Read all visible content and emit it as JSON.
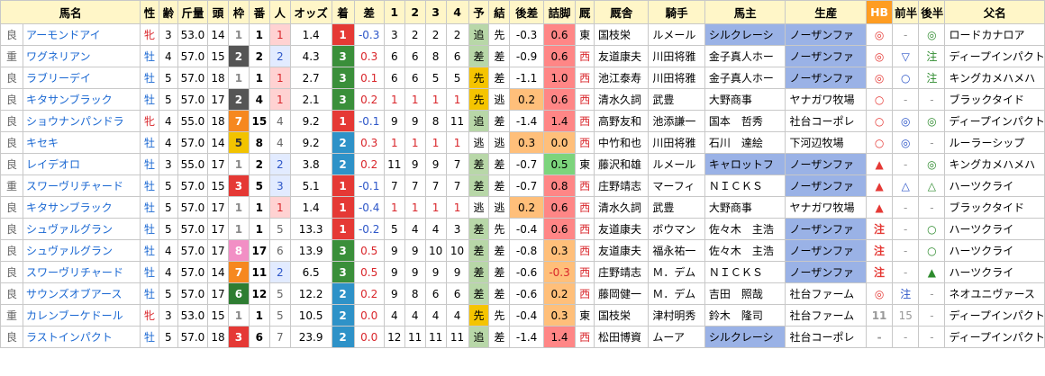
{
  "header": [
    "馬名",
    "性",
    "齢",
    "斤量",
    "頭",
    "枠",
    "番",
    "人",
    "オッズ",
    "着",
    "差",
    "1",
    "2",
    "3",
    "4",
    "予",
    "結",
    "後差",
    "詰脚",
    "厩",
    "厩舎",
    "騎手",
    "馬主",
    "生産",
    "HB",
    "前半",
    "後半",
    "父名"
  ],
  "colors": {
    "header_bg": "#fff6c8",
    "hb_header": "#ff9d22",
    "waku": {
      "1": "#ffffff",
      "2": "#555555",
      "3": "#e53935",
      "4": "#3b78c6",
      "5": "#f2c300",
      "6": "#2e7d32",
      "7": "#f6881f",
      "8": "#f28fc5"
    },
    "chaku": {
      "1": "#e53935",
      "2": "#2e92c8",
      "3": "#3a8f3a"
    },
    "pred_senko": "#f5c400",
    "pred_sa": "#b8d7a8",
    "kosa_orange": "#ffbf7a",
    "kosa_green": "#a8e07a",
    "tsume_red": "#ff8686",
    "tsume_orange": "#ffbf7a",
    "tsume_green": "#7cd47c",
    "banushi_blue": "#9ab2e6",
    "seisan_blue": "#9ab2e6",
    "hb_red": "#e53935",
    "hb_blue": "#2d56c8",
    "half_green": "#2e8b2e"
  },
  "rows": [
    {
      "baba": "良",
      "name": "アーモンドアイ",
      "sex": "牝",
      "age": "3",
      "kin": "53.0",
      "to": "14",
      "waku": "1",
      "ban": "1",
      "nin": "1",
      "odds": "1.4",
      "chaku": "1",
      "sa": "-0.3",
      "c1": "3",
      "c2": "2",
      "c3": "2",
      "c4": "2",
      "pred": "追",
      "res": "先",
      "kosa": "-0.3",
      "tsume": "0.6",
      "tz": "東",
      "kyu": "国枝栄",
      "kishu": "ルメール",
      "banushi": "シルクレーシ",
      "seisan": "ノーザンファ",
      "hb": "◎",
      "zen": "-",
      "kou": "◎",
      "father": "ロードカナロア"
    },
    {
      "baba": "重",
      "name": "ワグネリアン",
      "sex": "牡",
      "age": "4",
      "kin": "57.0",
      "to": "15",
      "waku": "2",
      "ban": "2",
      "nin": "2",
      "odds": "4.3",
      "chaku": "3",
      "sa": "0.3",
      "c1": "6",
      "c2": "6",
      "c3": "8",
      "c4": "6",
      "pred": "差",
      "res": "差",
      "kosa": "-0.9",
      "tsume": "0.6",
      "tz": "西",
      "kyu": "友道康夫",
      "kishu": "川田将雅",
      "banushi": "金子真人ホー",
      "seisan": "ノーザンファ",
      "hb": "◎",
      "zen": "▽",
      "kou": "注",
      "father": "ディープインパクト"
    },
    {
      "baba": "良",
      "name": "ラブリーデイ",
      "sex": "牡",
      "age": "5",
      "kin": "57.0",
      "to": "18",
      "waku": "1",
      "ban": "1",
      "nin": "1",
      "odds": "2.7",
      "chaku": "3",
      "sa": "0.1",
      "c1": "6",
      "c2": "6",
      "c3": "5",
      "c4": "5",
      "pred": "先",
      "res": "差",
      "kosa": "-1.1",
      "tsume": "1.0",
      "tz": "西",
      "kyu": "池江泰寿",
      "kishu": "川田将雅",
      "banushi": "金子真人ホー",
      "seisan": "ノーザンファ",
      "hb": "◎",
      "zen": "○",
      "kou": "注",
      "father": "キングカメハメハ"
    },
    {
      "baba": "良",
      "name": "キタサンブラック",
      "sex": "牡",
      "age": "5",
      "kin": "57.0",
      "to": "17",
      "waku": "2",
      "ban": "4",
      "nin": "1",
      "odds": "2.1",
      "chaku": "3",
      "sa": "0.2",
      "c1": "1",
      "c2": "1",
      "c3": "1",
      "c4": "1",
      "pred": "先",
      "res": "逃",
      "kosa": "0.2",
      "tsume": "0.6",
      "tz": "西",
      "kyu": "清水久詞",
      "kishu": "武豊",
      "banushi": "大野商事",
      "seisan": "ヤナガワ牧場",
      "hb": "○",
      "zen": "-",
      "kou": "-",
      "father": "ブラックタイド"
    },
    {
      "baba": "良",
      "name": "ショウナンパンドラ",
      "sex": "牝",
      "age": "4",
      "kin": "55.0",
      "to": "18",
      "waku": "7",
      "ban": "15",
      "nin": "4",
      "odds": "9.2",
      "chaku": "1",
      "sa": "-0.1",
      "c1": "9",
      "c2": "9",
      "c3": "8",
      "c4": "11",
      "pred": "追",
      "res": "差",
      "kosa": "-1.4",
      "tsume": "1.4",
      "tz": "西",
      "kyu": "高野友和",
      "kishu": "池添謙一",
      "banushi": "国本　哲秀",
      "seisan": "社台コーポレ",
      "hb": "○",
      "zen": "◎",
      "kou": "◎",
      "father": "ディープインパクト"
    },
    {
      "baba": "良",
      "name": "キセキ",
      "sex": "牡",
      "age": "4",
      "kin": "57.0",
      "to": "14",
      "waku": "5",
      "ban": "8",
      "nin": "4",
      "odds": "9.2",
      "chaku": "2",
      "sa": "0.3",
      "c1": "1",
      "c2": "1",
      "c3": "1",
      "c4": "1",
      "pred": "逃",
      "res": "逃",
      "kosa": "0.3",
      "tsume": "0.0",
      "tz": "西",
      "kyu": "中竹和也",
      "kishu": "川田将雅",
      "banushi": "石川　達絵",
      "seisan": "下河辺牧場",
      "hb": "○",
      "zen": "◎",
      "kou": "-",
      "father": "ルーラーシップ"
    },
    {
      "baba": "良",
      "name": "レイデオロ",
      "sex": "牡",
      "age": "3",
      "kin": "55.0",
      "to": "17",
      "waku": "1",
      "ban": "2",
      "nin": "2",
      "odds": "3.8",
      "chaku": "2",
      "sa": "0.2",
      "c1": "11",
      "c2": "9",
      "c3": "9",
      "c4": "7",
      "pred": "差",
      "res": "差",
      "kosa": "-0.7",
      "tsume": "0.5",
      "tz": "東",
      "kyu": "藤沢和雄",
      "kishu": "ルメール",
      "banushi": "キャロットフ",
      "seisan": "ノーザンファ",
      "hb": "▲",
      "zen": "-",
      "kou": "◎",
      "father": "キングカメハメハ"
    },
    {
      "baba": "重",
      "name": "スワーヴリチャード",
      "sex": "牡",
      "age": "5",
      "kin": "57.0",
      "to": "15",
      "waku": "3",
      "ban": "5",
      "nin": "3",
      "odds": "5.1",
      "chaku": "1",
      "sa": "-0.1",
      "c1": "7",
      "c2": "7",
      "c3": "7",
      "c4": "7",
      "pred": "差",
      "res": "差",
      "kosa": "-0.7",
      "tsume": "0.8",
      "tz": "西",
      "kyu": "庄野靖志",
      "kishu": "マーフィ",
      "banushi": "ＮＩＣＫＳ",
      "seisan": "ノーザンファ",
      "hb": "▲",
      "zen": "△",
      "kou": "△",
      "father": "ハーツクライ"
    },
    {
      "baba": "良",
      "name": "キタサンブラック",
      "sex": "牡",
      "age": "5",
      "kin": "57.0",
      "to": "17",
      "waku": "1",
      "ban": "1",
      "nin": "1",
      "odds": "1.4",
      "chaku": "1",
      "sa": "-0.4",
      "c1": "1",
      "c2": "1",
      "c3": "1",
      "c4": "1",
      "pred": "逃",
      "res": "逃",
      "kosa": "0.2",
      "tsume": "0.6",
      "tz": "西",
      "kyu": "清水久詞",
      "kishu": "武豊",
      "banushi": "大野商事",
      "seisan": "ヤナガワ牧場",
      "hb": "▲",
      "zen": "-",
      "kou": "-",
      "father": "ブラックタイド"
    },
    {
      "baba": "良",
      "name": "シュヴァルグラン",
      "sex": "牡",
      "age": "5",
      "kin": "57.0",
      "to": "17",
      "waku": "1",
      "ban": "1",
      "nin": "5",
      "odds": "13.3",
      "chaku": "1",
      "sa": "-0.2",
      "c1": "5",
      "c2": "4",
      "c3": "4",
      "c4": "3",
      "pred": "差",
      "res": "先",
      "kosa": "-0.4",
      "tsume": "0.6",
      "tz": "西",
      "kyu": "友道康夫",
      "kishu": "ボウマン",
      "banushi": "佐々木　主浩",
      "seisan": "ノーザンファ",
      "hb": "注",
      "zen": "-",
      "kou": "○",
      "father": "ハーツクライ"
    },
    {
      "baba": "良",
      "name": "シュヴァルグラン",
      "sex": "牡",
      "age": "4",
      "kin": "57.0",
      "to": "17",
      "waku": "8",
      "ban": "17",
      "nin": "6",
      "odds": "13.9",
      "chaku": "3",
      "sa": "0.5",
      "c1": "9",
      "c2": "9",
      "c3": "10",
      "c4": "10",
      "pred": "差",
      "res": "差",
      "kosa": "-0.8",
      "tsume": "0.3",
      "tz": "西",
      "kyu": "友道康夫",
      "kishu": "福永祐一",
      "banushi": "佐々木　主浩",
      "seisan": "ノーザンファ",
      "hb": "注",
      "zen": "-",
      "kou": "○",
      "father": "ハーツクライ"
    },
    {
      "baba": "良",
      "name": "スワーヴリチャード",
      "sex": "牡",
      "age": "4",
      "kin": "57.0",
      "to": "14",
      "waku": "7",
      "ban": "11",
      "nin": "2",
      "odds": "6.5",
      "chaku": "3",
      "sa": "0.5",
      "c1": "9",
      "c2": "9",
      "c3": "9",
      "c4": "9",
      "pred": "差",
      "res": "差",
      "kosa": "-0.6",
      "tsume": "-0.3",
      "tz": "西",
      "kyu": "庄野靖志",
      "kishu": "Ｍ．デム",
      "banushi": "ＮＩＣＫＳ",
      "seisan": "ノーザンファ",
      "hb": "注",
      "zen": "-",
      "kou": "▲",
      "father": "ハーツクライ"
    },
    {
      "baba": "良",
      "name": "サウンズオブアース",
      "sex": "牡",
      "age": "5",
      "kin": "57.0",
      "to": "17",
      "waku": "6",
      "ban": "12",
      "nin": "5",
      "odds": "12.2",
      "chaku": "2",
      "sa": "0.2",
      "c1": "9",
      "c2": "8",
      "c3": "6",
      "c4": "6",
      "pred": "差",
      "res": "差",
      "kosa": "-0.6",
      "tsume": "0.2",
      "tz": "西",
      "kyu": "藤岡健一",
      "kishu": "Ｍ．デム",
      "banushi": "吉田　照哉",
      "seisan": "社台ファーム",
      "hb": "◎",
      "zen": "注",
      "kou": "-",
      "father": "ネオユニヴァース"
    },
    {
      "baba": "重",
      "name": "カレンブーケドール",
      "sex": "牝",
      "age": "3",
      "kin": "53.0",
      "to": "15",
      "waku": "1",
      "ban": "1",
      "nin": "5",
      "odds": "10.5",
      "chaku": "2",
      "sa": "0.0",
      "c1": "4",
      "c2": "4",
      "c3": "4",
      "c4": "4",
      "pred": "先",
      "res": "先",
      "kosa": "-0.4",
      "tsume": "0.3",
      "tz": "東",
      "kyu": "国枝栄",
      "kishu": "津村明秀",
      "banushi": "鈴木　隆司",
      "seisan": "社台ファーム",
      "hb": "11",
      "zen": "15",
      "kou": "-",
      "father": "ディープインパクト"
    },
    {
      "baba": "良",
      "name": "ラストインパクト",
      "sex": "牡",
      "age": "5",
      "kin": "57.0",
      "to": "18",
      "waku": "3",
      "ban": "6",
      "nin": "7",
      "odds": "23.9",
      "chaku": "2",
      "sa": "0.0",
      "c1": "12",
      "c2": "11",
      "c3": "11",
      "c4": "11",
      "pred": "追",
      "res": "差",
      "kosa": "-1.4",
      "tsume": "1.4",
      "tz": "西",
      "kyu": "松田博資",
      "kishu": "ムーア",
      "banushi": "シルクレーシ",
      "seisan": "社台コーポレ",
      "hb": "-",
      "zen": "-",
      "kou": "-",
      "father": "ディープインパクト"
    }
  ]
}
